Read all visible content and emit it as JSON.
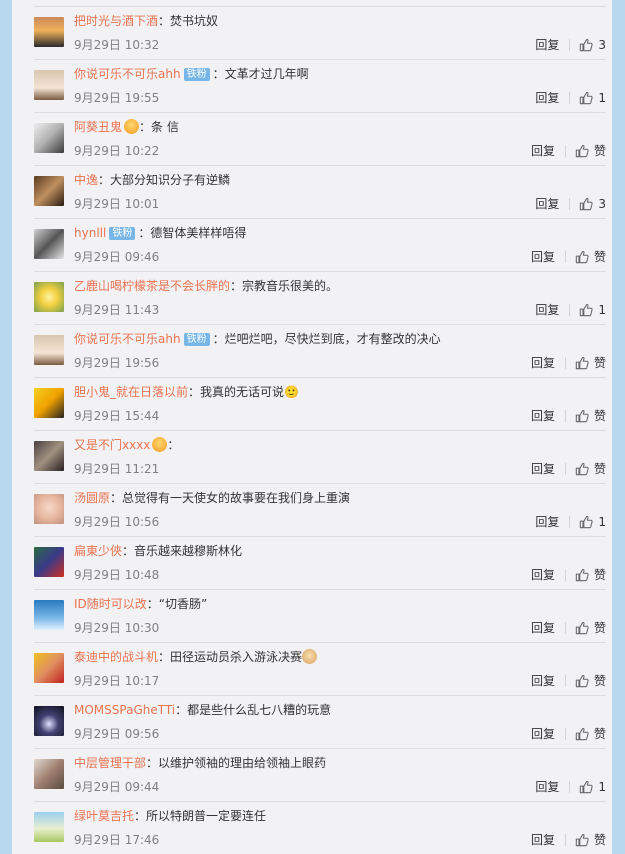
{
  "labels": {
    "reply": "回复"
  },
  "colors": {
    "username": "#eb7350",
    "badge": "#77b6e6"
  },
  "comments": [
    {
      "user": "把时光与酒下酒",
      "sep": "：",
      "text": "焚书坑奴",
      "time": "9月29日 10:32",
      "likes": "3"
    },
    {
      "user": "你说可乐不可乐ahh",
      "badge": "铁粉",
      "sep": "：",
      "text": "文革才过几年啊",
      "time": "9月29日 19:55",
      "likes": "1"
    },
    {
      "user": "阿葵丑鬼",
      "emoji": "face-emoji",
      "sep": "：",
      "text": "条 信",
      "time": "9月29日 10:22",
      "likes": "赞"
    },
    {
      "user": "中逸",
      "sep": "：",
      "text": "大部分知识分子有逆鳞",
      "time": "9月29日 10:01",
      "likes": "3"
    },
    {
      "user": "hynlll",
      "badge": "铁粉",
      "sep": "：",
      "text": "德智体美样样唔得",
      "time": "9月29日 09:46",
      "likes": "赞"
    },
    {
      "user": "乙鹿山喝柠檬茶是不会长胖的",
      "sep": "：",
      "text": "宗教音乐很美的。",
      "time": "9月29日 11:43",
      "likes": "1"
    },
    {
      "user": "你说可乐不可乐ahh",
      "badge": "铁粉",
      "sep": "：",
      "text": "烂吧烂吧，尽快烂到底，才有整改的决心",
      "time": "9月29日 19:56",
      "likes": "赞"
    },
    {
      "user": "胆小鬼_就在日落以前",
      "sep": "：",
      "text": "我真的无话可说🙂",
      "time": "9月29日 15:44",
      "likes": "赞"
    },
    {
      "user": "又是不门xxxx",
      "emoji": "laugh-cry-emoji",
      "sep": "：",
      "text": "",
      "time": "9月29日 11:21",
      "likes": "赞"
    },
    {
      "user": "汤圆原",
      "sep": "：",
      "text": "总觉得有一天使女的故事要在我们身上重演",
      "time": "9月29日 10:56",
      "likes": "1"
    },
    {
      "user": "扁東少俠",
      "sep": "：",
      "text": "音乐越来越穆斯林化",
      "time": "9月29日 10:48",
      "likes": "赞"
    },
    {
      "user": "ID随时可以改",
      "sep": "：",
      "text": "“切香肠”",
      "time": "9月29日 10:30",
      "likes": "赞"
    },
    {
      "user": "泰迪中的战斗机",
      "sep": "：",
      "text": "田径运动员杀入游泳决赛",
      "emoji_after": "doge-emoji",
      "time": "9月29日 10:17",
      "likes": "赞"
    },
    {
      "user": "MOMSSPaGheTTi",
      "sep": "：",
      "text": "都是些什么乱七八糟的玩意",
      "time": "9月29日 09:56",
      "likes": "赞"
    },
    {
      "user": "中层管理干部",
      "sep": "：",
      "text": "以维护领袖的理由给领袖上眼药",
      "time": "9月29日 09:44",
      "likes": "1"
    },
    {
      "user": "绿叶莫吉托",
      "sep": "：",
      "text": "所以特朗普一定要连任",
      "time": "9月29日 17:46",
      "likes": "赞"
    }
  ]
}
